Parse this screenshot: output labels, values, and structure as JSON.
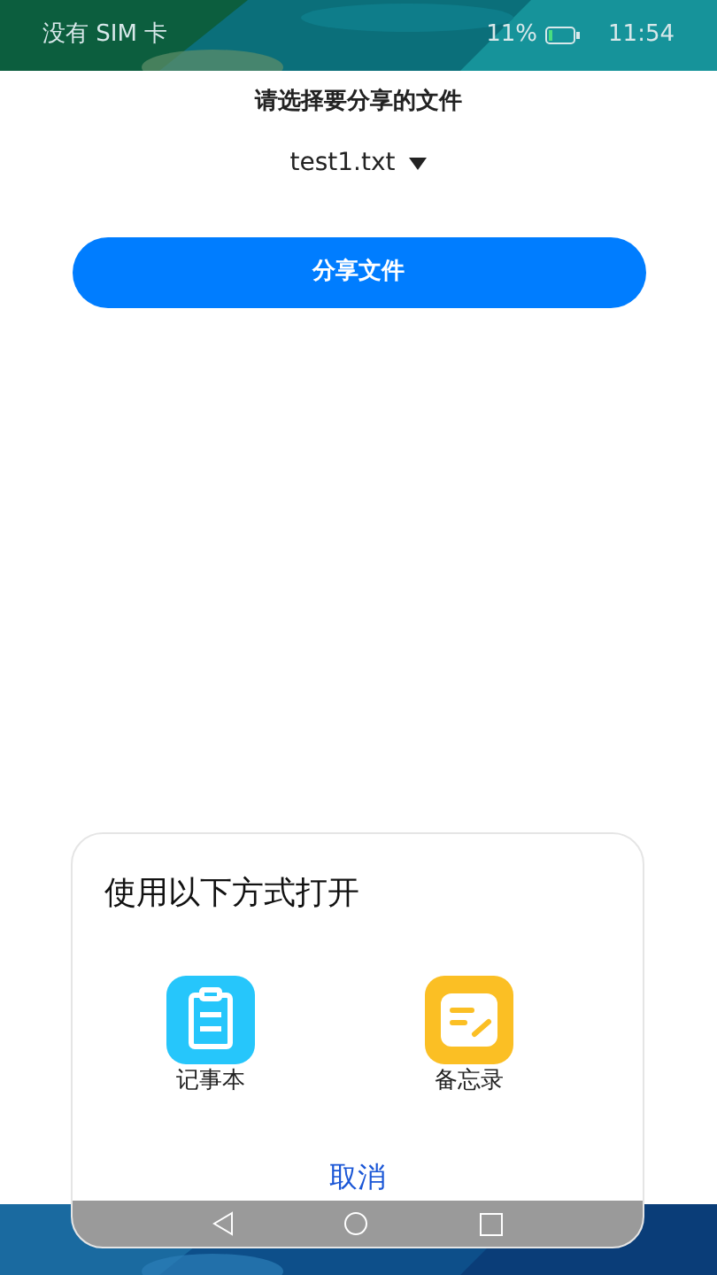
{
  "status_bar": {
    "carrier": "没有 SIM 卡",
    "battery": "11%",
    "time": "11:54"
  },
  "prompt": "请选择要分享的文件",
  "file_select": {
    "value": "test1.txt"
  },
  "share_button": "分享文件",
  "sheet": {
    "title": "使用以下方式打开",
    "apps": [
      {
        "name": "记事本",
        "color": "#26c6fb"
      },
      {
        "name": "备忘录",
        "color": "#fbbf24"
      }
    ],
    "cancel": "取消"
  }
}
